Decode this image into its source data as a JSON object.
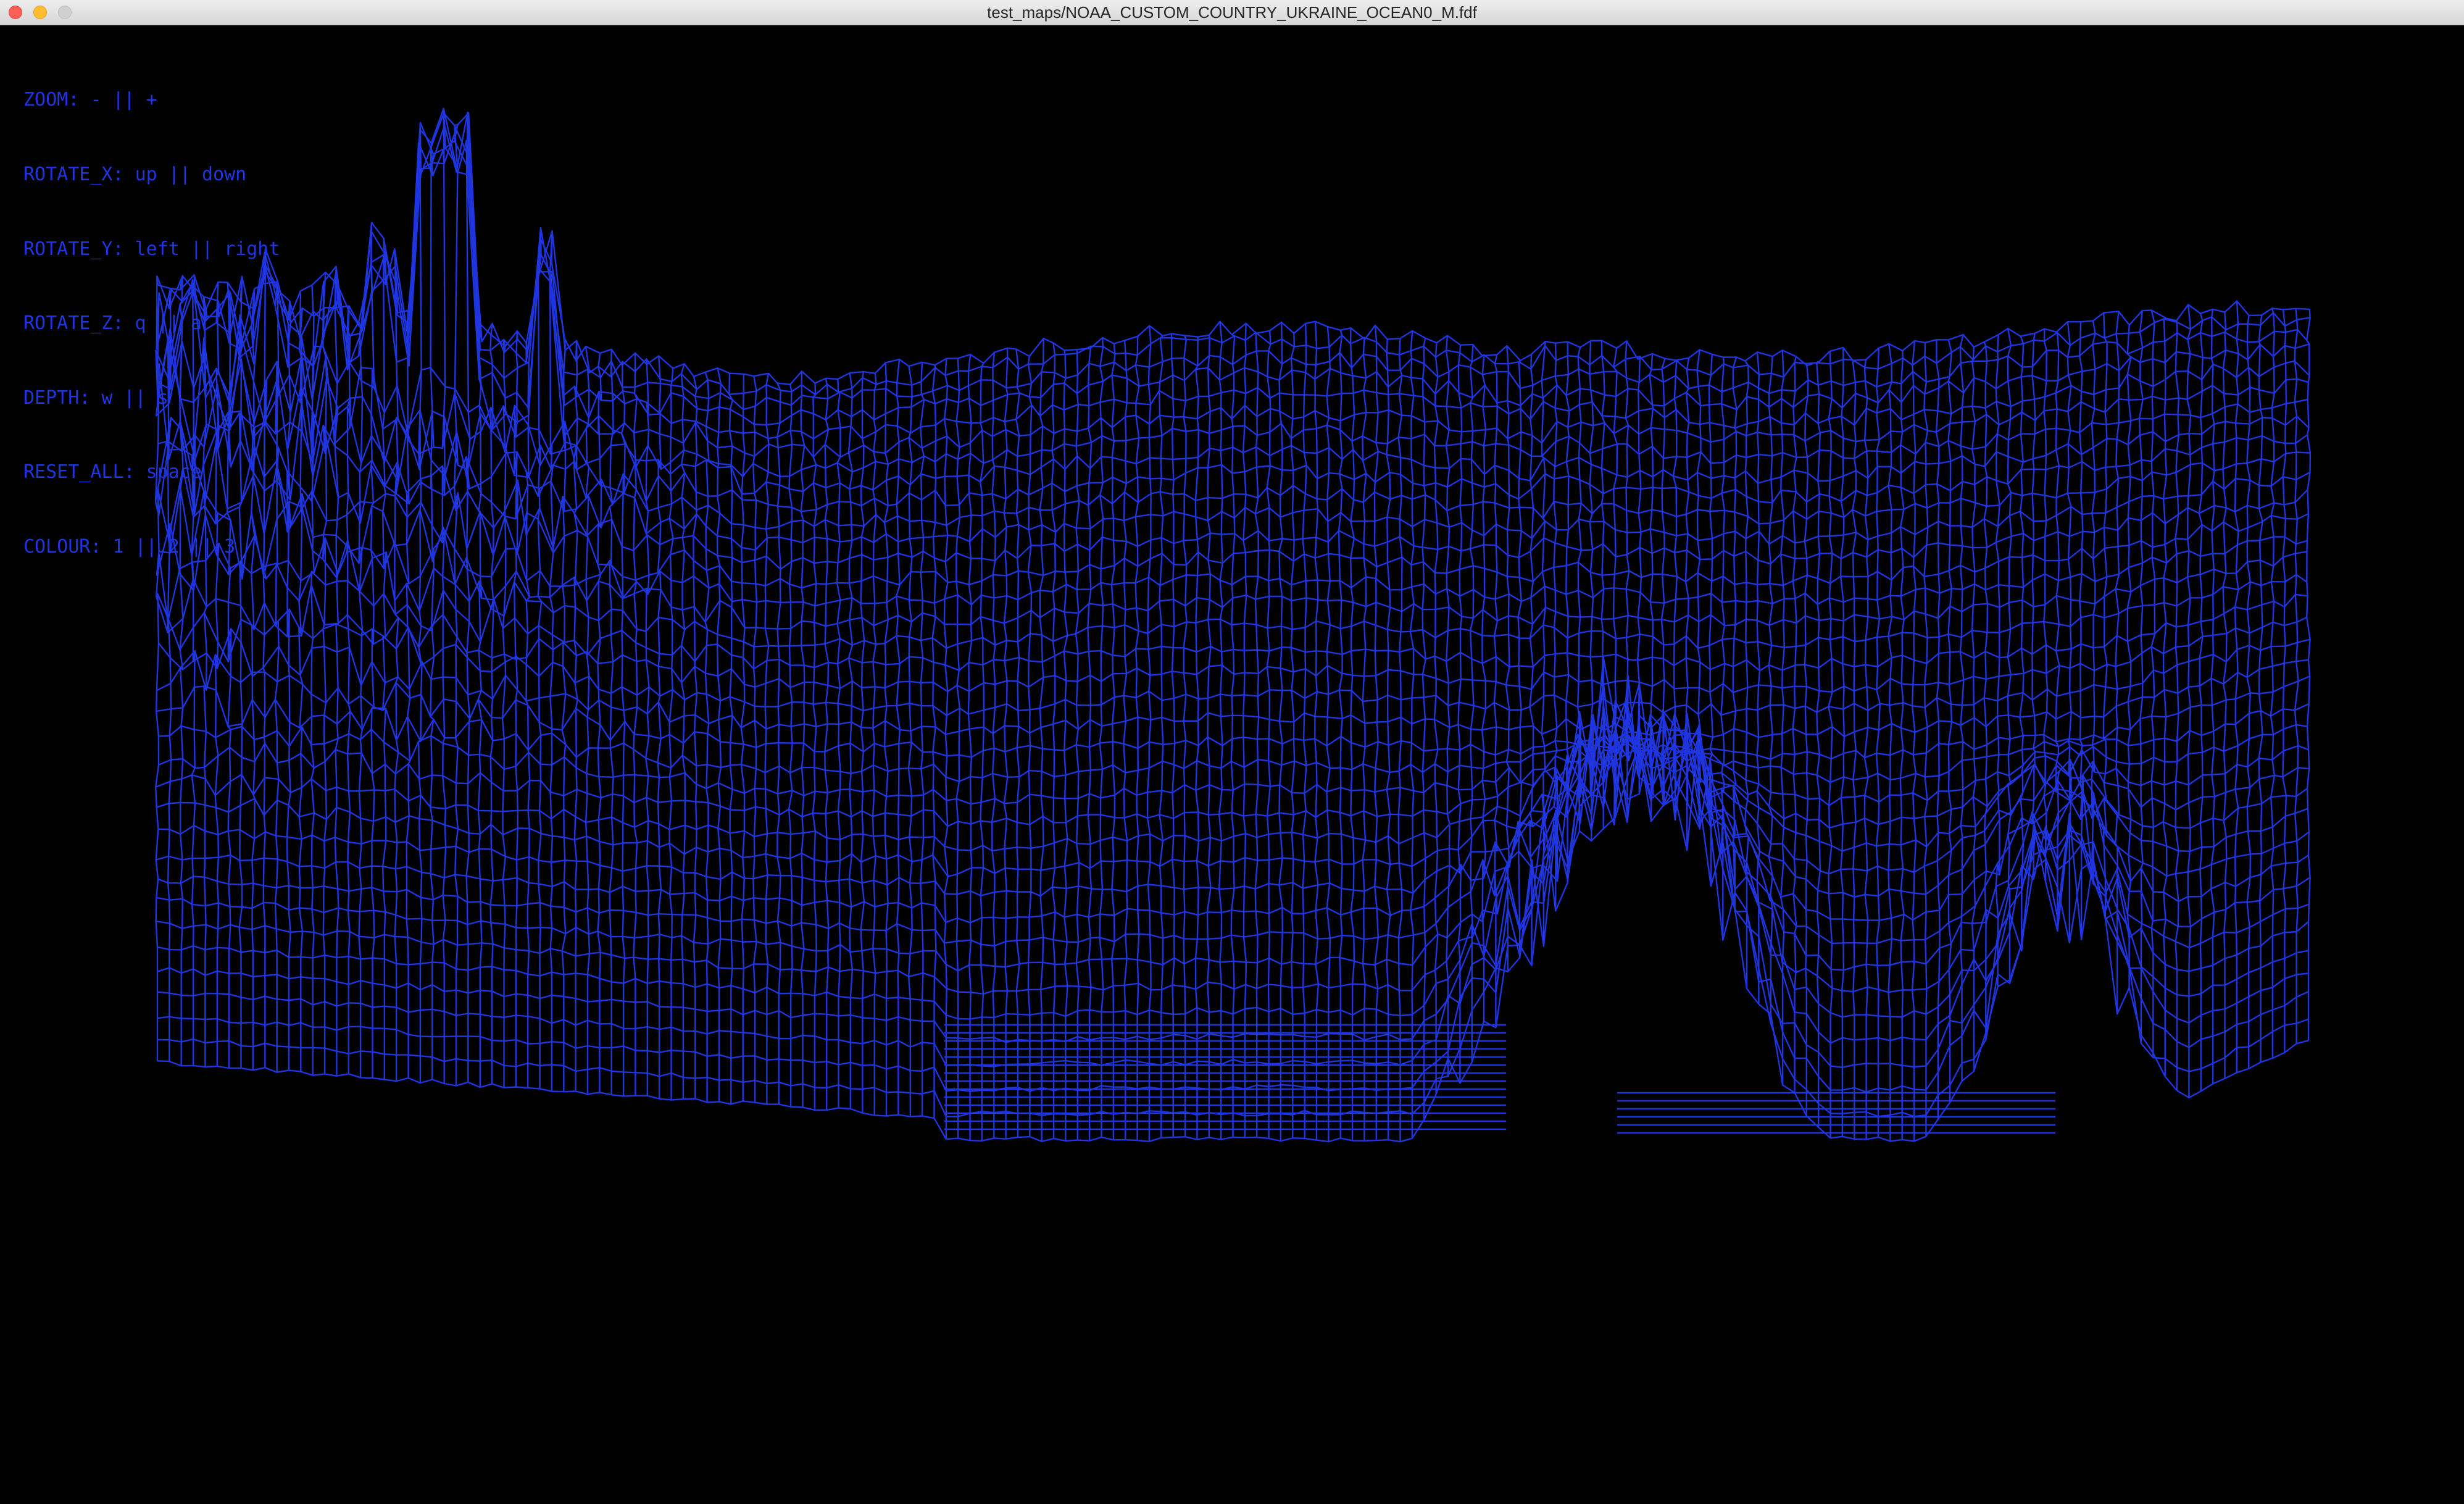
{
  "window": {
    "title": "test_maps/NOAA_CUSTOM_COUNTRY_UKRAINE_OCEAN0_M.fdf"
  },
  "controls": [
    "ZOOM: - || +",
    "ROTATE_X: up || down",
    "ROTATE_Y: left || right",
    "ROTATE_Z: q || a",
    "DEPTH: w || s",
    "RESET_ALL: space",
    "COLOUR: 1 || 2 || 3"
  ],
  "colors": {
    "background": "#000000",
    "wireframe": "#1f35e0",
    "hud_text": "#1f35e0"
  }
}
